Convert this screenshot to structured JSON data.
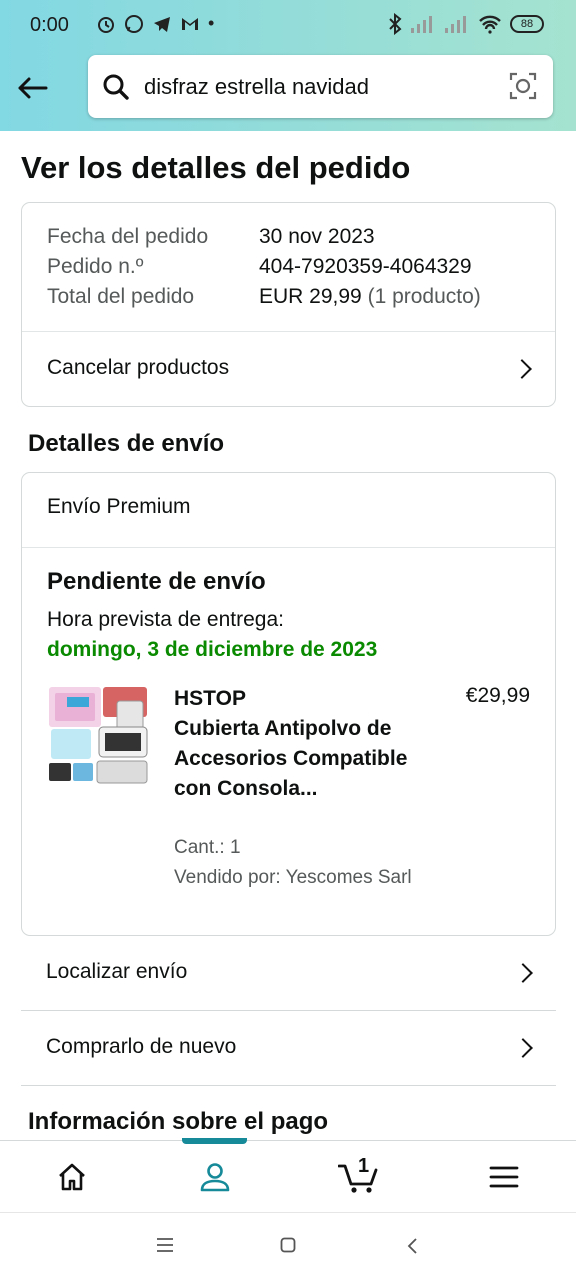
{
  "status_bar": {
    "time": "0:00",
    "battery": "88"
  },
  "search": {
    "query": "disfraz estrella navidad"
  },
  "page": {
    "title": "Ver los detalles del pedido"
  },
  "order": {
    "date_label": "Fecha del pedido",
    "date_value": "30 nov 2023",
    "number_label": "Pedido n.º",
    "number_value": "404-7920359-4064329",
    "total_label": "Total del pedido",
    "total_value": "EUR 29,99",
    "total_count": "(1 producto)",
    "cancel_label": "Cancelar productos"
  },
  "shipping": {
    "section_title": "Detalles de envío",
    "type": "Envío Premium",
    "status": "Pendiente de envío",
    "eta_label": "Hora prevista de entrega:",
    "eta_date": "domingo, 3 de diciembre de 2023",
    "product": {
      "brand": "HSTOP",
      "title": "Cubierta Antipolvo de Accesorios Compatible con Consola...",
      "price": "€29,99",
      "qty": "Cant.: 1",
      "seller": "Vendido por: Yescomes Sarl"
    }
  },
  "actions": {
    "track": "Localizar envío",
    "buy_again": "Comprarlo de nuevo"
  },
  "payment": {
    "section_title": "Información sobre el pago"
  },
  "bottom_nav": {
    "cart_count": "1",
    "items": [
      "home-icon",
      "account-icon",
      "cart-icon",
      "menu-icon"
    ],
    "accent": "#168a99"
  }
}
